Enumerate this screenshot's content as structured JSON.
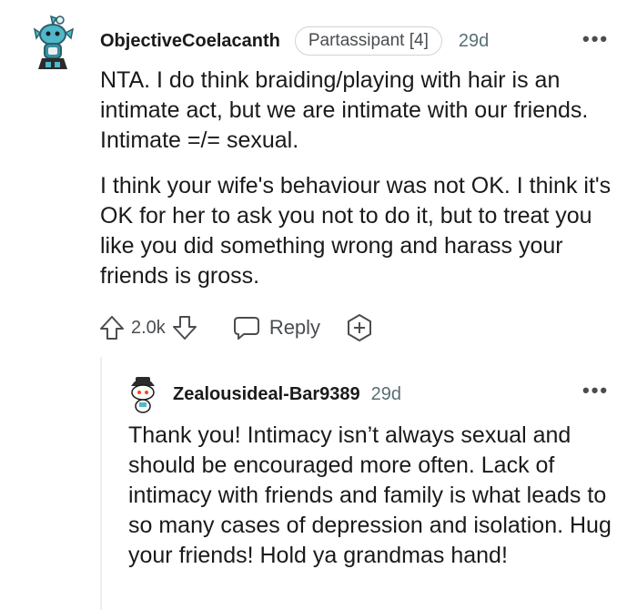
{
  "comment": {
    "username": "ObjectiveCoelacanth",
    "flair": "Partassipant [4]",
    "time": "29d",
    "more": "•••",
    "paragraphs": [
      "NTA. I do think braiding/playing with hair is an intimate act, but we are intimate with our friends. Intimate =/= sexual.",
      "I think your wife's behaviour was not OK. I think it's OK for her to ask you not to do it, but to treat you like you did something wrong and harass your friends is gross."
    ],
    "votes": "2.0k",
    "reply_label": "Reply"
  },
  "reply": {
    "username": "Zealousideal-Bar9389",
    "time": "29d",
    "more": "•••",
    "text": "Thank you! Intimacy isn’t always sexual and should be encouraged more often. Lack of intimacy with friends and family is what leads to so many cases of depression and isolation. Hug your friends! Hold ya grandmas hand!"
  },
  "colors": {
    "text": "#1a1a1b",
    "meta": "#576f76",
    "icon": "#4a4d50",
    "thread_line": "#edeff1",
    "avatar_teal": "#4fb8c9"
  },
  "icons": {
    "avatar1": "snoo-avatar-icon",
    "avatar2": "snoo-avatar-icon",
    "upvote": "arrow-up-icon",
    "downvote": "arrow-down-icon",
    "reply": "speech-bubble-icon",
    "award": "award-plus-icon",
    "more": "more-dots-icon"
  }
}
